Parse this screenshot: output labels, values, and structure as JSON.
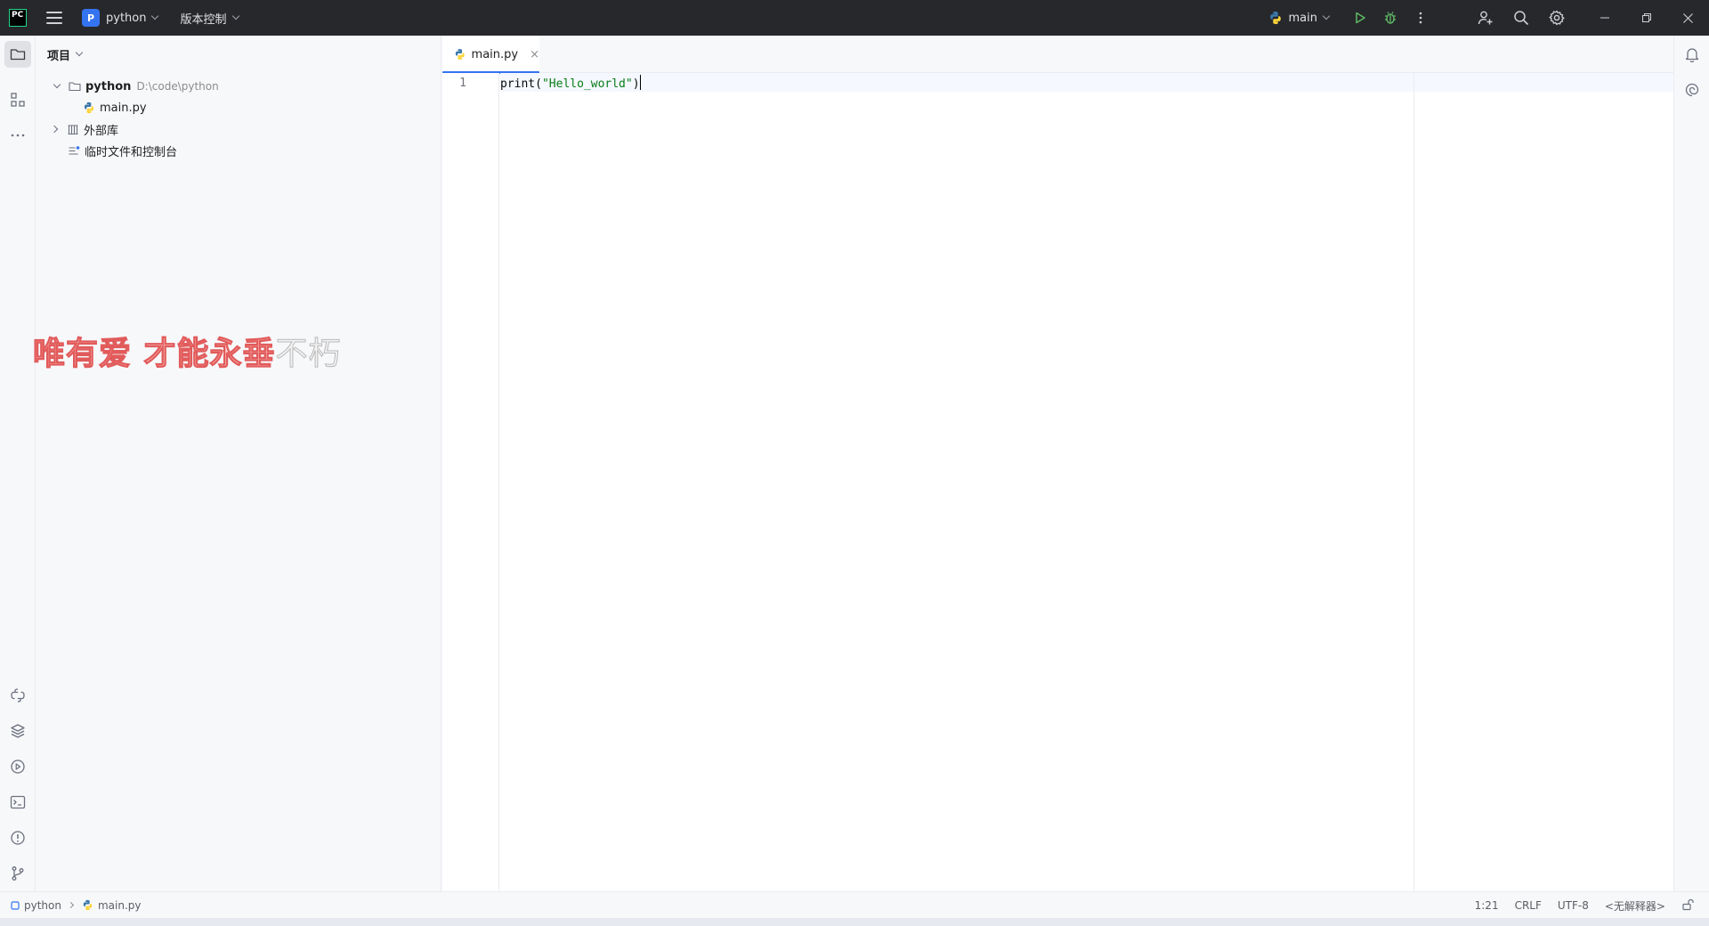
{
  "titlebar": {
    "logo_text": "PC",
    "project_badge": "P",
    "project_name": "python",
    "vcs_label": "版本控制",
    "run_config": "main"
  },
  "project_panel": {
    "title": "项目",
    "tree": [
      {
        "label": "python",
        "path": "D:\\code\\python"
      },
      {
        "label": "main.py"
      },
      {
        "label": "外部库"
      },
      {
        "label": "临时文件和控制台"
      }
    ]
  },
  "watermark": {
    "part1": "唯有爱 才能永垂",
    "part2": "不朽"
  },
  "editor": {
    "tab_label": "main.py",
    "tab_close": "×",
    "line_number": "1",
    "code": {
      "fn": "print(",
      "str": "\"Hello_world\"",
      "close": ")"
    }
  },
  "statusbar": {
    "breadcrumb_project": "python",
    "breadcrumb_file": "main.py",
    "position": "1:21",
    "line_ending": "CRLF",
    "encoding": "UTF-8",
    "interpreter": "<无解释器>"
  },
  "colors": {
    "accent": "#3574f0",
    "titlebar_bg": "#27282c",
    "run_green": "#5fb865",
    "string_green": "#067d17"
  }
}
